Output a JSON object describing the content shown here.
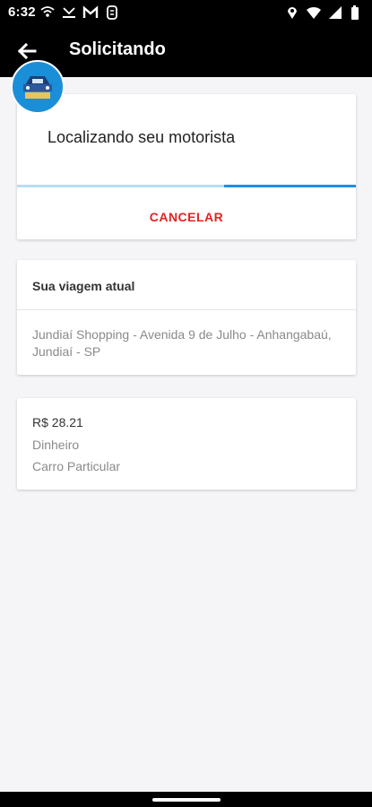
{
  "status_bar": {
    "time": "6:32",
    "left_icons": [
      "wifi-calling-icon",
      "missed-call-icon",
      "gmail-icon",
      "sync-icon"
    ],
    "right_icons": [
      "location-icon",
      "wifi-icon",
      "signal-icon",
      "battery-icon"
    ]
  },
  "app_bar": {
    "title": "Solicitando",
    "back_icon": "arrow-back-icon",
    "background": "#000000"
  },
  "avatar": {
    "icon": "taxi-logo-icon",
    "color": "#1a8fd8"
  },
  "locating_card": {
    "status_text": "Localizando seu motorista",
    "cancel_label": "CANCELAR",
    "cancel_color": "#e52222",
    "progress_color": "#1f8ee6"
  },
  "trip_card": {
    "heading": "Sua viagem atual",
    "address": "Jundiaí Shopping - Avenida 9 de Julho - Anhangabaú, Jundiaí - SP"
  },
  "payment_card": {
    "price": "R$ 28.21",
    "method": "Dinheiro",
    "vehicle": "Carro Particular"
  }
}
